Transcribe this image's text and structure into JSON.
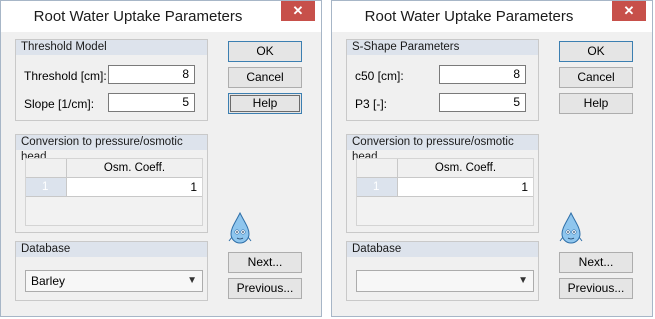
{
  "dialogs": [
    {
      "title": "Root Water Uptake Parameters",
      "params_group": {
        "header": "Threshold Model",
        "fields": [
          {
            "label": "Threshold [cm]:",
            "value": "8"
          },
          {
            "label": "Slope [1/cm]:",
            "value": "5"
          }
        ]
      },
      "conversion_group": {
        "header": "Conversion to pressure/osmotic head",
        "column_header": "Osm. Coeff.",
        "rows": [
          {
            "num": "1",
            "value": "1"
          }
        ]
      },
      "database_group": {
        "header": "Database",
        "selected": "Barley"
      },
      "buttons": {
        "ok": "OK",
        "cancel": "Cancel",
        "help": "Help",
        "next": "Next...",
        "previous": "Previous..."
      }
    },
    {
      "title": "Root Water Uptake Parameters",
      "params_group": {
        "header": "S-Shape Parameters",
        "fields": [
          {
            "label": "c50 [cm]:",
            "value": "8"
          },
          {
            "label": "P3 [-]:",
            "value": "5"
          }
        ]
      },
      "conversion_group": {
        "header": "Conversion to pressure/osmotic head",
        "column_header": "Osm. Coeff.",
        "rows": [
          {
            "num": "1",
            "value": "1"
          }
        ]
      },
      "database_group": {
        "header": "Database",
        "selected": ""
      },
      "buttons": {
        "ok": "OK",
        "cancel": "Cancel",
        "help": "Help",
        "next": "Next...",
        "previous": "Previous..."
      }
    }
  ],
  "icons": {
    "close": "close-icon",
    "dropdown": "chevron-down-icon",
    "mascot": "water-drop-mascot-icon"
  },
  "colors": {
    "title_bar": "#ffffff",
    "close_button": "#c7504a",
    "group_header": "#dde3ec",
    "focus_border": "#3c7fb1"
  }
}
